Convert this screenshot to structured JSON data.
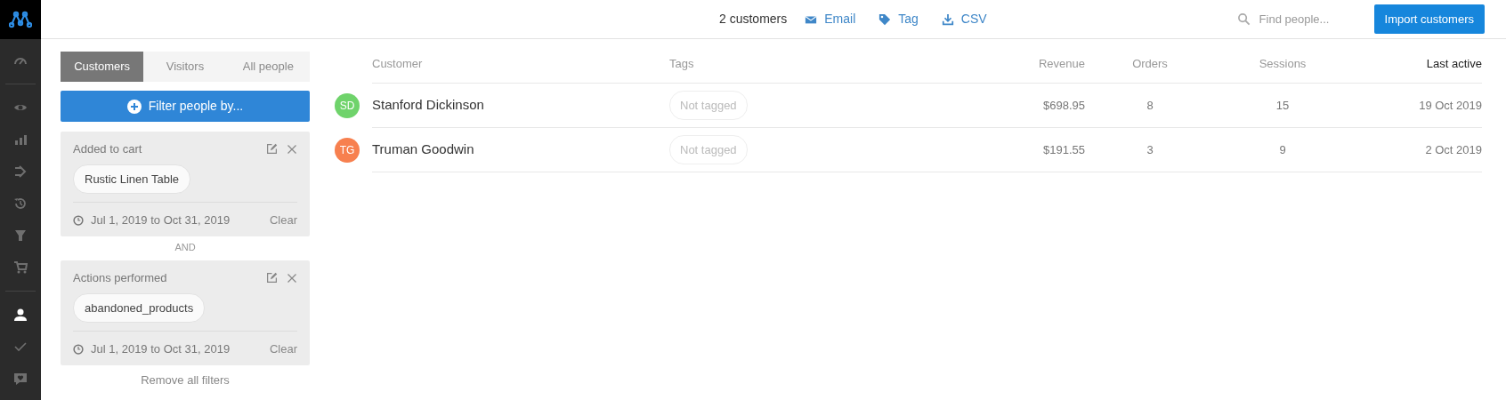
{
  "sidebar": {
    "items": [
      {
        "selected": false
      },
      {
        "selected": false
      },
      {
        "selected": false
      },
      {
        "selected": false
      },
      {
        "selected": false
      },
      {
        "selected": false
      },
      {
        "selected": false
      },
      {
        "selected": true
      },
      {
        "selected": false
      },
      {
        "selected": false
      }
    ]
  },
  "toolbar": {
    "count": "2 customers",
    "actions": [
      {
        "kind": "email",
        "label": "Email"
      },
      {
        "kind": "tag",
        "label": "Tag"
      },
      {
        "kind": "download",
        "label": "CSV"
      }
    ],
    "search": {
      "placeholder": "Find people..."
    },
    "import_button": "Import customers"
  },
  "tabs": [
    {
      "label": "Customers",
      "selected": true
    },
    {
      "label": "Visitors",
      "selected": false
    },
    {
      "label": "All people",
      "selected": false
    }
  ],
  "filter_button": "Filter people by...",
  "filters": [
    {
      "title": "Added to cart",
      "value": "Rustic Linen Table",
      "date_range": "Jul 1, 2019 to Oct 31, 2019",
      "clear": "Clear"
    },
    {
      "title": "Actions performed",
      "value": "abandoned_products",
      "date_range": "Jul 1, 2019 to Oct 31, 2019",
      "clear": "Clear"
    }
  ],
  "connector": "AND",
  "remove_all": "Remove all filters",
  "table": {
    "columns": [
      {
        "label": "Customer",
        "sorted": false
      },
      {
        "label": "Tags",
        "sorted": false
      },
      {
        "label": "Revenue",
        "sorted": false
      },
      {
        "label": "Orders",
        "sorted": false
      },
      {
        "label": "Sessions",
        "sorted": false
      },
      {
        "label": "Last active",
        "sorted": true
      }
    ],
    "rows": [
      {
        "initials": "SD",
        "color": "#6fd36b",
        "name": "Stanford Dickinson",
        "tags": "Not tagged",
        "revenue": "$698.95",
        "orders": "8",
        "sessions": "15",
        "last_active": "19 Oct 2019"
      },
      {
        "initials": "TG",
        "color": "#f7804f",
        "name": "Truman Goodwin",
        "tags": "Not tagged",
        "revenue": "$191.55",
        "orders": "3",
        "sessions": "9",
        "last_active": "2 Oct 2019"
      }
    ]
  }
}
